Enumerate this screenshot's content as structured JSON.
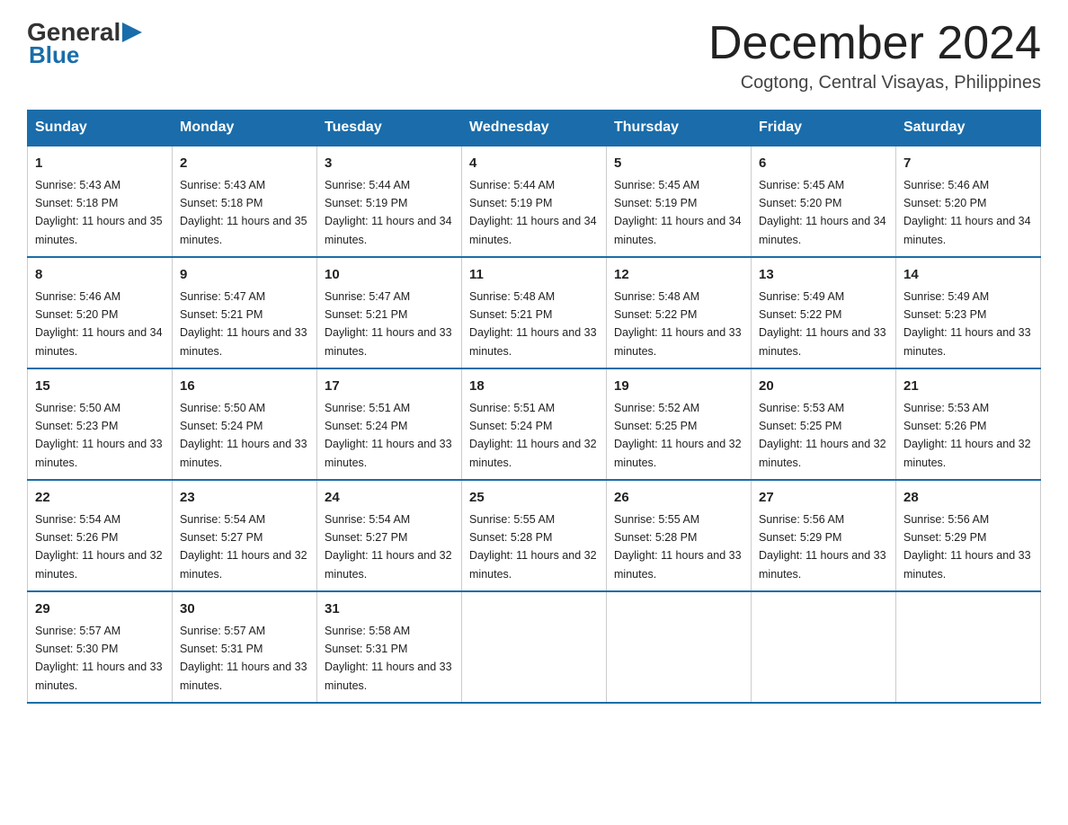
{
  "header": {
    "logo_general": "General",
    "logo_blue": "Blue",
    "month_title": "December 2024",
    "location": "Cogtong, Central Visayas, Philippines"
  },
  "days_of_week": [
    "Sunday",
    "Monday",
    "Tuesday",
    "Wednesday",
    "Thursday",
    "Friday",
    "Saturday"
  ],
  "weeks": [
    [
      {
        "day": "1",
        "sunrise": "5:43 AM",
        "sunset": "5:18 PM",
        "daylight": "11 hours and 35 minutes."
      },
      {
        "day": "2",
        "sunrise": "5:43 AM",
        "sunset": "5:18 PM",
        "daylight": "11 hours and 35 minutes."
      },
      {
        "day": "3",
        "sunrise": "5:44 AM",
        "sunset": "5:19 PM",
        "daylight": "11 hours and 34 minutes."
      },
      {
        "day": "4",
        "sunrise": "5:44 AM",
        "sunset": "5:19 PM",
        "daylight": "11 hours and 34 minutes."
      },
      {
        "day": "5",
        "sunrise": "5:45 AM",
        "sunset": "5:19 PM",
        "daylight": "11 hours and 34 minutes."
      },
      {
        "day": "6",
        "sunrise": "5:45 AM",
        "sunset": "5:20 PM",
        "daylight": "11 hours and 34 minutes."
      },
      {
        "day": "7",
        "sunrise": "5:46 AM",
        "sunset": "5:20 PM",
        "daylight": "11 hours and 34 minutes."
      }
    ],
    [
      {
        "day": "8",
        "sunrise": "5:46 AM",
        "sunset": "5:20 PM",
        "daylight": "11 hours and 34 minutes."
      },
      {
        "day": "9",
        "sunrise": "5:47 AM",
        "sunset": "5:21 PM",
        "daylight": "11 hours and 33 minutes."
      },
      {
        "day": "10",
        "sunrise": "5:47 AM",
        "sunset": "5:21 PM",
        "daylight": "11 hours and 33 minutes."
      },
      {
        "day": "11",
        "sunrise": "5:48 AM",
        "sunset": "5:21 PM",
        "daylight": "11 hours and 33 minutes."
      },
      {
        "day": "12",
        "sunrise": "5:48 AM",
        "sunset": "5:22 PM",
        "daylight": "11 hours and 33 minutes."
      },
      {
        "day": "13",
        "sunrise": "5:49 AM",
        "sunset": "5:22 PM",
        "daylight": "11 hours and 33 minutes."
      },
      {
        "day": "14",
        "sunrise": "5:49 AM",
        "sunset": "5:23 PM",
        "daylight": "11 hours and 33 minutes."
      }
    ],
    [
      {
        "day": "15",
        "sunrise": "5:50 AM",
        "sunset": "5:23 PM",
        "daylight": "11 hours and 33 minutes."
      },
      {
        "day": "16",
        "sunrise": "5:50 AM",
        "sunset": "5:24 PM",
        "daylight": "11 hours and 33 minutes."
      },
      {
        "day": "17",
        "sunrise": "5:51 AM",
        "sunset": "5:24 PM",
        "daylight": "11 hours and 33 minutes."
      },
      {
        "day": "18",
        "sunrise": "5:51 AM",
        "sunset": "5:24 PM",
        "daylight": "11 hours and 32 minutes."
      },
      {
        "day": "19",
        "sunrise": "5:52 AM",
        "sunset": "5:25 PM",
        "daylight": "11 hours and 32 minutes."
      },
      {
        "day": "20",
        "sunrise": "5:53 AM",
        "sunset": "5:25 PM",
        "daylight": "11 hours and 32 minutes."
      },
      {
        "day": "21",
        "sunrise": "5:53 AM",
        "sunset": "5:26 PM",
        "daylight": "11 hours and 32 minutes."
      }
    ],
    [
      {
        "day": "22",
        "sunrise": "5:54 AM",
        "sunset": "5:26 PM",
        "daylight": "11 hours and 32 minutes."
      },
      {
        "day": "23",
        "sunrise": "5:54 AM",
        "sunset": "5:27 PM",
        "daylight": "11 hours and 32 minutes."
      },
      {
        "day": "24",
        "sunrise": "5:54 AM",
        "sunset": "5:27 PM",
        "daylight": "11 hours and 32 minutes."
      },
      {
        "day": "25",
        "sunrise": "5:55 AM",
        "sunset": "5:28 PM",
        "daylight": "11 hours and 32 minutes."
      },
      {
        "day": "26",
        "sunrise": "5:55 AM",
        "sunset": "5:28 PM",
        "daylight": "11 hours and 33 minutes."
      },
      {
        "day": "27",
        "sunrise": "5:56 AM",
        "sunset": "5:29 PM",
        "daylight": "11 hours and 33 minutes."
      },
      {
        "day": "28",
        "sunrise": "5:56 AM",
        "sunset": "5:29 PM",
        "daylight": "11 hours and 33 minutes."
      }
    ],
    [
      {
        "day": "29",
        "sunrise": "5:57 AM",
        "sunset": "5:30 PM",
        "daylight": "11 hours and 33 minutes."
      },
      {
        "day": "30",
        "sunrise": "5:57 AM",
        "sunset": "5:31 PM",
        "daylight": "11 hours and 33 minutes."
      },
      {
        "day": "31",
        "sunrise": "5:58 AM",
        "sunset": "5:31 PM",
        "daylight": "11 hours and 33 minutes."
      },
      null,
      null,
      null,
      null
    ]
  ],
  "labels": {
    "sunrise": "Sunrise:",
    "sunset": "Sunset:",
    "daylight": "Daylight:"
  }
}
